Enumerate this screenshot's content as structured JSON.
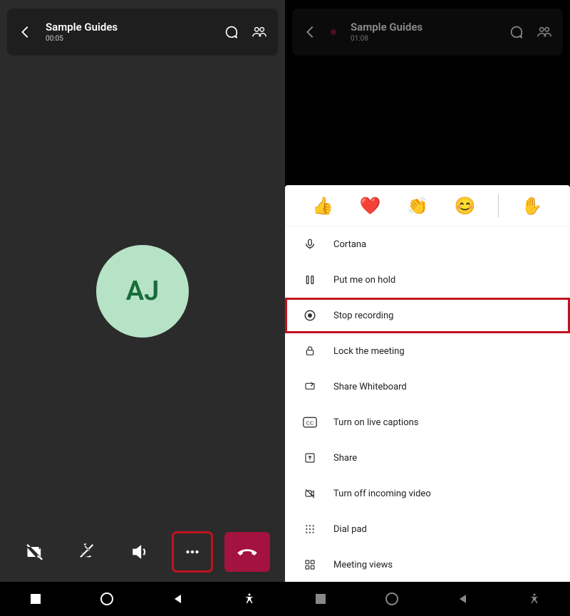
{
  "left": {
    "header": {
      "title": "Sample Guides",
      "time": "00:05"
    },
    "avatar_initials": "AJ"
  },
  "right": {
    "header": {
      "title": "Sample Guides",
      "time": "01:08"
    },
    "reactions": [
      "👍",
      "❤️",
      "👏",
      "😊",
      "✋"
    ],
    "menu": [
      {
        "label": "Cortana"
      },
      {
        "label": "Put me on hold"
      },
      {
        "label": "Stop recording",
        "hl": true
      },
      {
        "label": "Lock the meeting"
      },
      {
        "label": "Share Whiteboard"
      },
      {
        "label": "Turn on live captions"
      },
      {
        "label": "Share"
      },
      {
        "label": "Turn off incoming video"
      },
      {
        "label": "Dial pad"
      },
      {
        "label": "Meeting views"
      }
    ]
  }
}
